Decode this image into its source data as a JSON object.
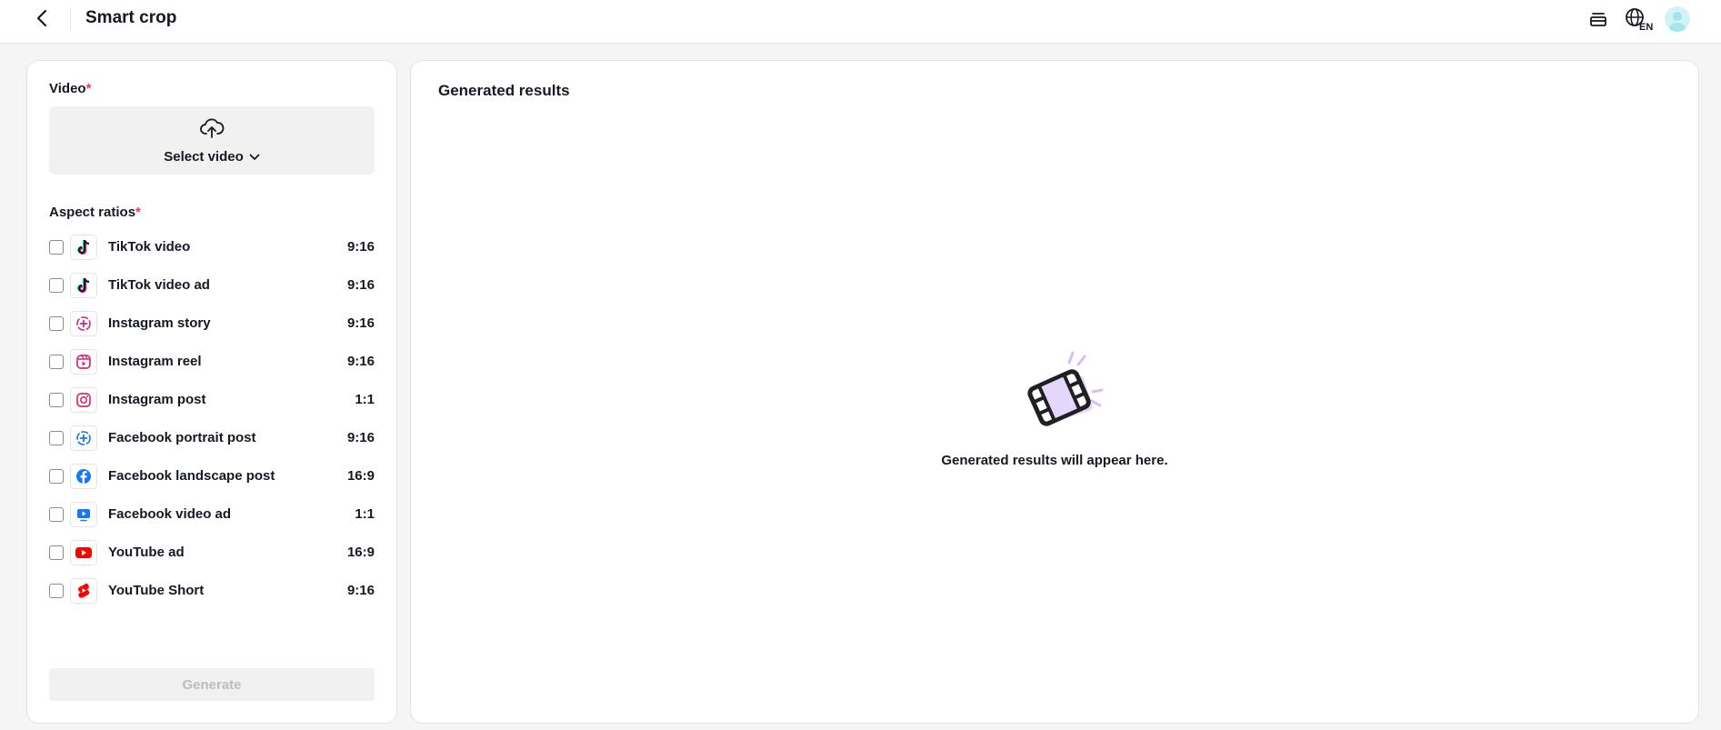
{
  "header": {
    "title": "Smart crop",
    "back_icon": "chevron-left-icon",
    "tasks_icon": "stack-icon",
    "language_code": "EN",
    "language_icon": "globe-icon"
  },
  "form": {
    "video_label": "Video",
    "required_mark": "*",
    "select_video_label": "Select video",
    "upload_icon": "cloud-upload-icon",
    "aspect_label": "Aspect ratios",
    "ratios": [
      {
        "name": "TikTok video",
        "ratio": "9:16",
        "icon": "tiktok-icon"
      },
      {
        "name": "TikTok video ad",
        "ratio": "9:16",
        "icon": "tiktok-icon"
      },
      {
        "name": "Instagram story",
        "ratio": "9:16",
        "icon": "instagram-story-icon"
      },
      {
        "name": "Instagram reel",
        "ratio": "9:16",
        "icon": "instagram-reel-icon"
      },
      {
        "name": "Instagram post",
        "ratio": "1:1",
        "icon": "instagram-icon"
      },
      {
        "name": "Facebook portrait post",
        "ratio": "9:16",
        "icon": "facebook-story-icon"
      },
      {
        "name": "Facebook landscape post",
        "ratio": "16:9",
        "icon": "facebook-icon"
      },
      {
        "name": "Facebook video ad",
        "ratio": "1:1",
        "icon": "facebook-video-icon"
      },
      {
        "name": "YouTube ad",
        "ratio": "16:9",
        "icon": "youtube-icon"
      },
      {
        "name": "YouTube Short",
        "ratio": "9:16",
        "icon": "youtube-shorts-icon"
      }
    ],
    "generate_label": "Generate"
  },
  "results": {
    "title": "Generated results",
    "empty_text": "Generated results will appear here.",
    "empty_icon": "film-icon"
  },
  "colors": {
    "required": "#fe2c55",
    "film_accent": "#e5d6fb",
    "tiktok_cyan": "#25f4ee",
    "tiktok_red": "#fe2c55",
    "instagram_pink": "#d62976",
    "facebook_blue": "#1877f2",
    "youtube_red": "#ff0000"
  }
}
